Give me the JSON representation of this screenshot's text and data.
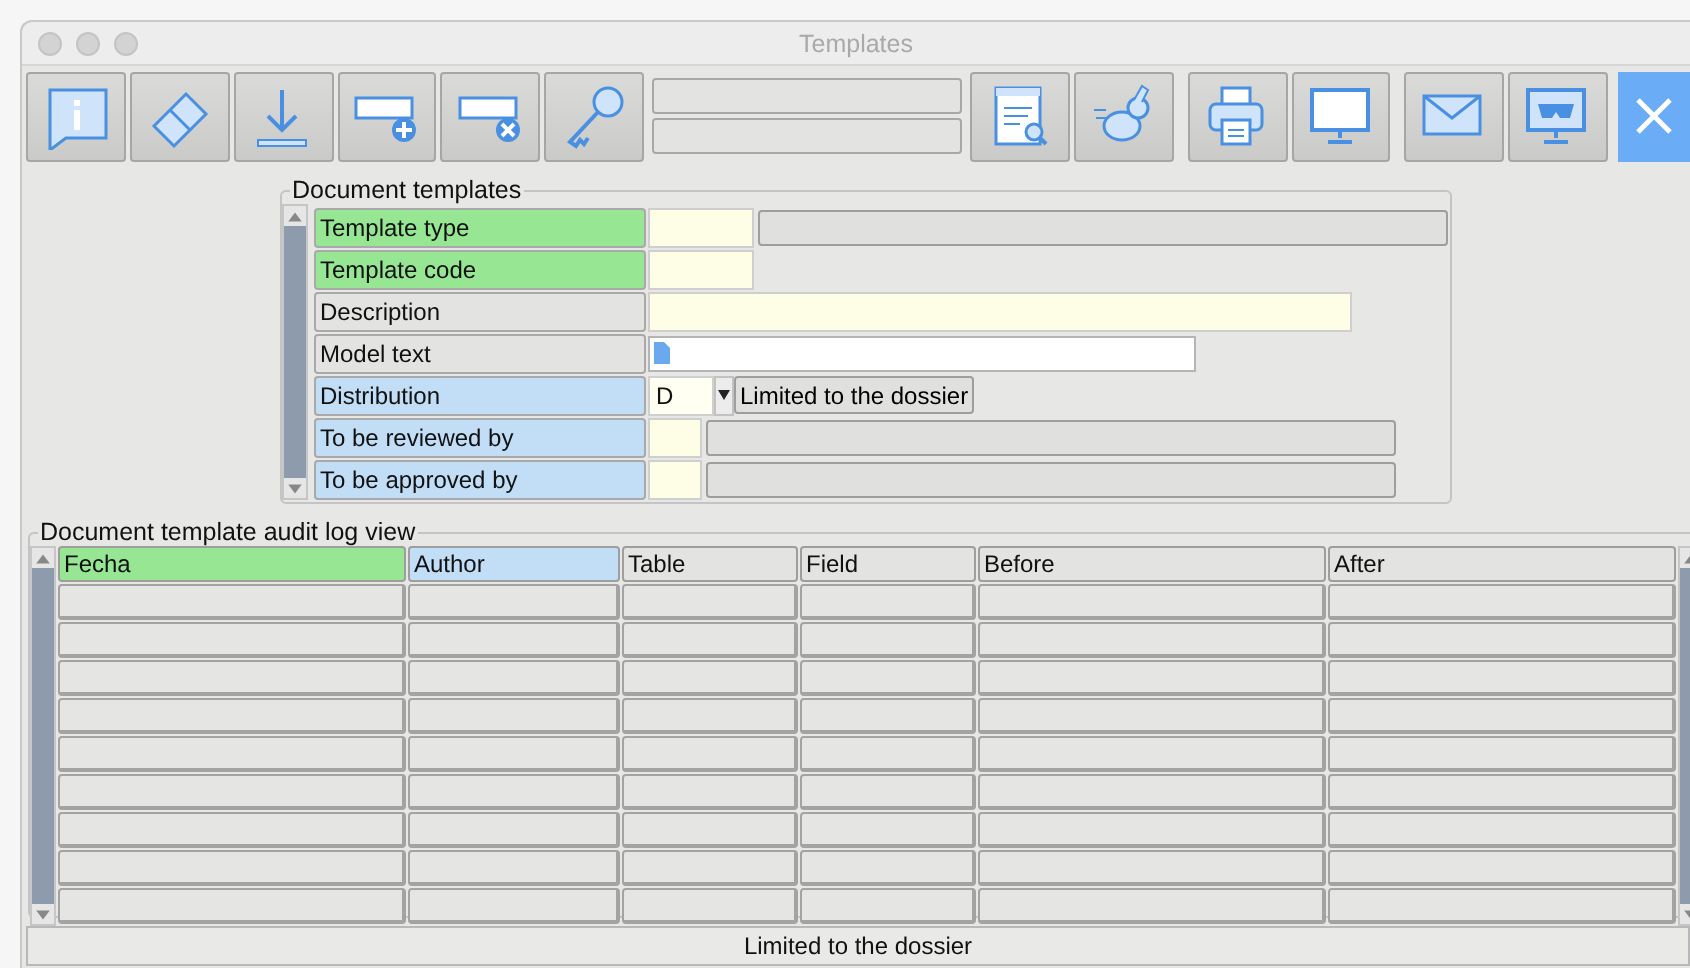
{
  "window": {
    "title": "Templates"
  },
  "form": {
    "title": "Document templates",
    "fields": [
      {
        "label": "Template type",
        "color": "#96e693",
        "kind": "lookup"
      },
      {
        "label": "Template code",
        "color": "#96e693",
        "kind": "code"
      },
      {
        "label": "Description",
        "color": "#e3e3e1",
        "kind": "text"
      },
      {
        "label": "Model text",
        "color": "#e3e3e1",
        "kind": "memo"
      },
      {
        "label": "Distribution",
        "color": "#c2def7",
        "kind": "select",
        "value": "D",
        "option": "Limited to the dossier"
      },
      {
        "label": "To be reviewed by",
        "color": "#c2def7",
        "kind": "short_lookup"
      },
      {
        "label": "To be approved by",
        "color": "#c2def7",
        "kind": "short_lookup"
      }
    ]
  },
  "audit": {
    "title": "Document template audit log view",
    "columns": [
      {
        "label": "Fecha",
        "color": "#96e693"
      },
      {
        "label": "Author",
        "color": "#c2def7"
      },
      {
        "label": "Table",
        "color": "#e3e3e1"
      },
      {
        "label": "Field",
        "color": "#e3e3e1"
      },
      {
        "label": "Before",
        "color": "#e3e3e1"
      },
      {
        "label": "After",
        "color": "#e3e3e1"
      }
    ]
  },
  "status_bar": "Limited to the dossier"
}
